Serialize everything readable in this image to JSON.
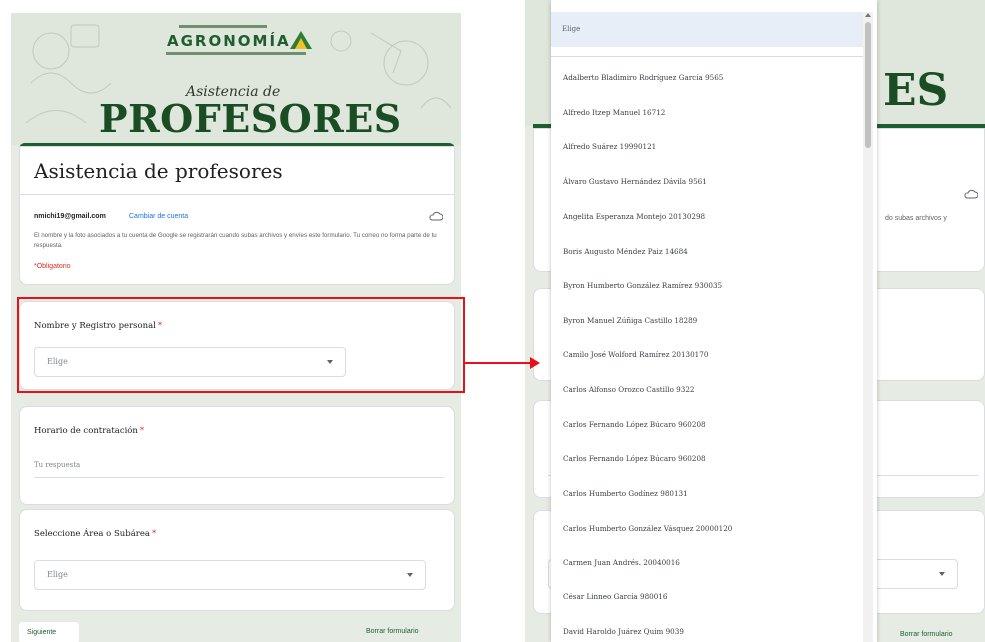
{
  "left_form": {
    "banner": {
      "logo_text": "AGRONOMÍA",
      "script_title": "Asistencia de",
      "big_title": "PROFESORES"
    },
    "title": "Asistencia de profesores",
    "account": {
      "email": "nmichi19@gmail.com",
      "switch_link": "Cambiar de cuenta",
      "note": "El nombre y la foto asociados a tu cuenta de Google se registrarán cuando subas archivos y envíes este formulario. Tu correo no forma parte de tu respuesta.",
      "required_note": "*Obligatorio"
    },
    "questions": [
      {
        "label": "Nombre y Registro personal",
        "required_mark": "*",
        "type": "dropdown",
        "placeholder": "Elige"
      },
      {
        "label": "Horario de contratación",
        "required_mark": "*",
        "type": "text",
        "placeholder": "Tu respuesta"
      },
      {
        "label": "Seleccione Área o Subárea",
        "required_mark": "*",
        "type": "dropdown",
        "placeholder": "Elige"
      }
    ],
    "footer": {
      "next_button": "Siguiente",
      "clear_link": "Borrar formulario"
    }
  },
  "right_form": {
    "banner_partial_title": "ES",
    "partial_note": "do subas archivos y",
    "footer_clear_link": "Borrar formulario"
  },
  "dropdown_list": {
    "header": "Elige",
    "options": [
      "Adalberto Bladimiro Rodríguez García 9565",
      "Alfredo Itzep Manuel 16712",
      "Alfredo Suárez 19990121",
      "Álvaro Gustavo Hernández Dávila 9561",
      "Angelita Esperanza Montejo 20130298",
      "Boris Augusto Méndez Paiz 14684",
      "Byron Humberto González Ramírez 930035",
      "Byron Manuel Zúñiga Castillo 18289",
      "Camilo José Wolford Ramírez 20130170",
      "Carlos Alfonso Orozco Castillo 9322",
      "Carlos Fernando López Búcaro 960208",
      "Carlos Fernando López Búcaro 960208",
      "Carlos Humberto Godínez 980131",
      "Carlos Humberto González Vásquez 20000120",
      "Carmen Juan Andrés. 20040016",
      "César Linneo García 980016",
      "David Haroldo Juárez Quim 9039"
    ]
  },
  "colors": {
    "accent": "#1d5e2f",
    "highlight": "#e8111a",
    "background": "#e6ece4",
    "required": "#d93025"
  }
}
